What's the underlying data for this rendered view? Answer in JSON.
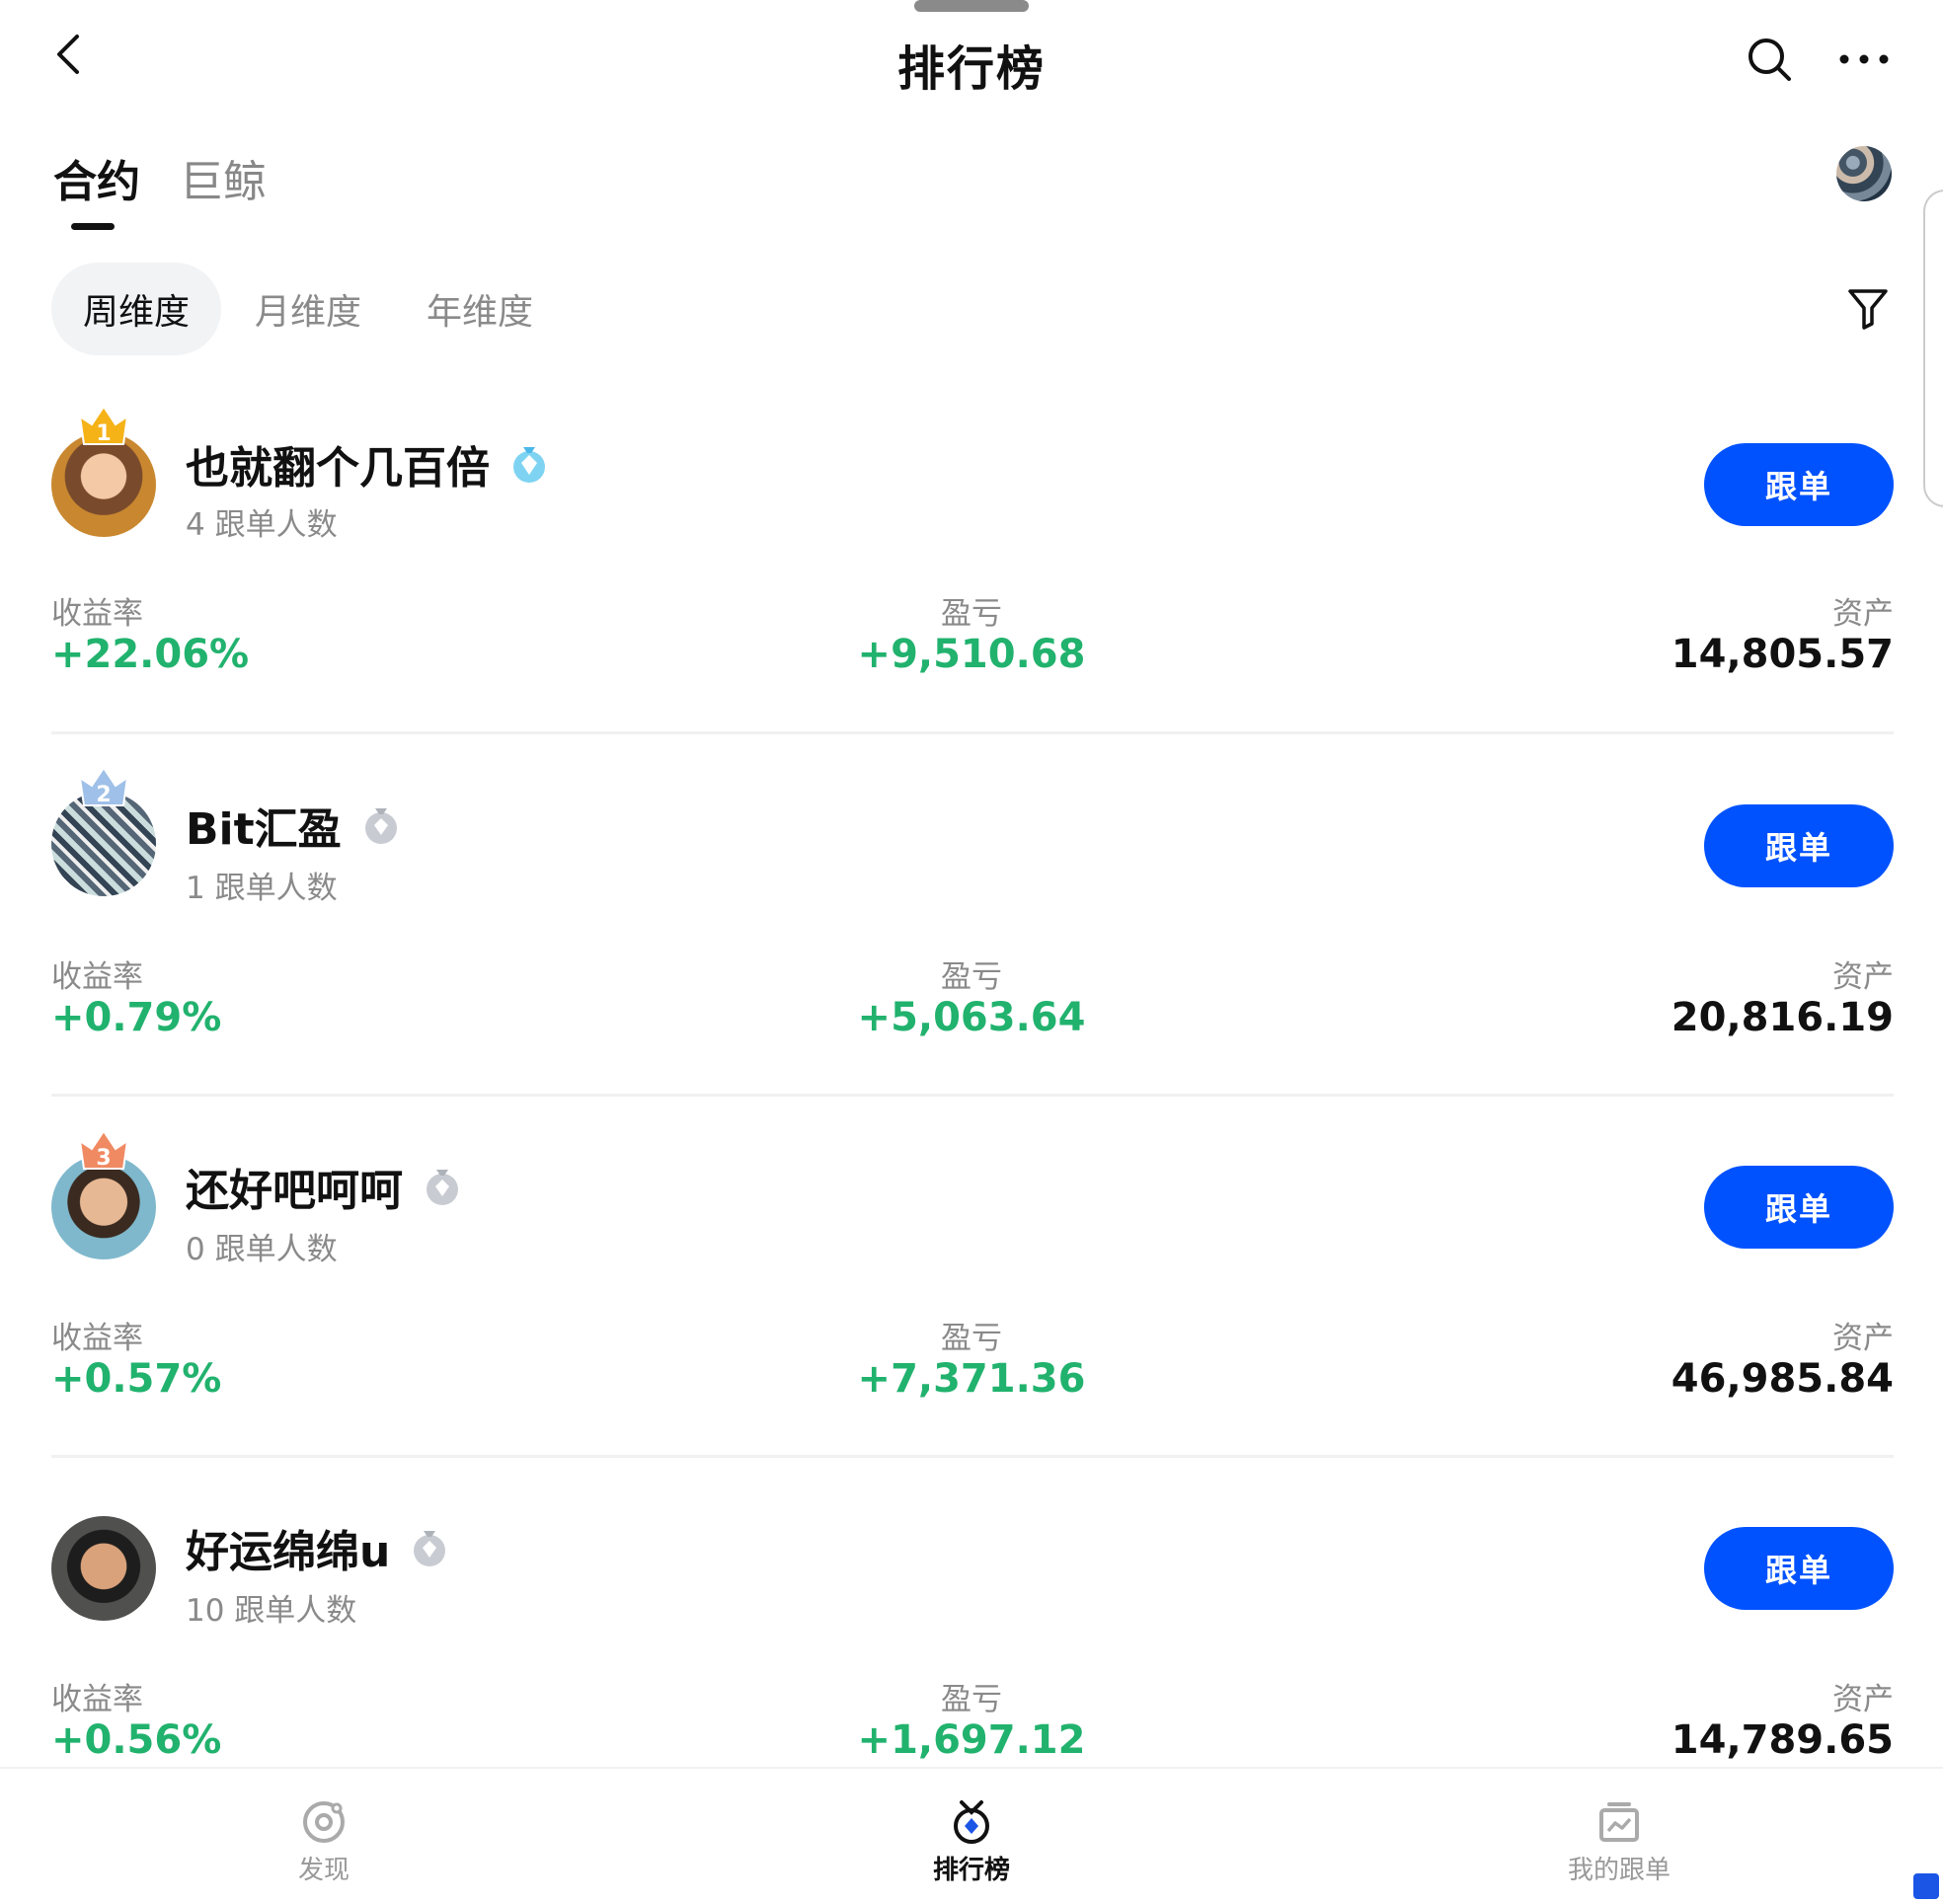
{
  "header": {
    "title": "排行榜"
  },
  "tabs": [
    {
      "label": "合约",
      "active": true
    },
    {
      "label": "巨鲸",
      "active": false
    }
  ],
  "periods": [
    {
      "label": "周维度",
      "active": true
    },
    {
      "label": "月维度",
      "active": false
    },
    {
      "label": "年维度",
      "active": false
    }
  ],
  "labels": {
    "yield": "收益率",
    "pnl": "盈亏",
    "assets": "资产",
    "follow": "跟单"
  },
  "traders": [
    {
      "rank": "1",
      "name": "也就翻个几百倍",
      "followers": "4 跟单人数",
      "yield": "+22.06%",
      "pnl": "+9,510.68",
      "assets": "14,805.57",
      "badge": "diamond"
    },
    {
      "rank": "2",
      "name": "Bit汇盈",
      "followers": "1 跟单人数",
      "yield": "+0.79%",
      "pnl": "+5,063.64",
      "assets": "20,816.19",
      "badge": "silver"
    },
    {
      "rank": "3",
      "name": "还好吧呵呵",
      "followers": "0 跟单人数",
      "yield": "+0.57%",
      "pnl": "+7,371.36",
      "assets": "46,985.84",
      "badge": "silver"
    },
    {
      "rank": "",
      "name": "好运绵绵u",
      "followers": "10 跟单人数",
      "yield": "+0.56%",
      "pnl": "+1,697.12",
      "assets": "14,789.65",
      "badge": "silver"
    }
  ],
  "nav": [
    {
      "label": "发现",
      "icon": "discover-icon"
    },
    {
      "label": "排行榜",
      "icon": "ranking-icon",
      "active": true
    },
    {
      "label": "我的跟单",
      "icon": "my-copy-icon"
    }
  ],
  "colors": {
    "accent": "#0052ff",
    "positive": "#21b26e"
  }
}
